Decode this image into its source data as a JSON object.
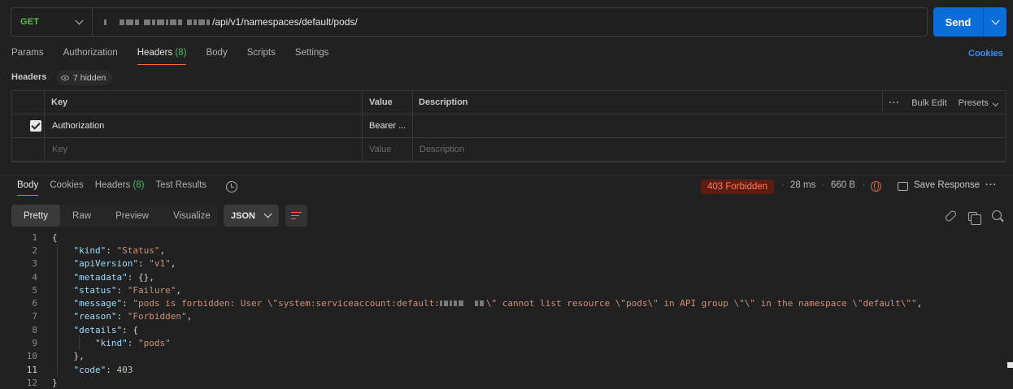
{
  "request": {
    "method": "GET",
    "url_path": "/api/v1/namespaces/default/pods/",
    "send_label": "Send"
  },
  "request_tabs": [
    {
      "label": "Params"
    },
    {
      "label": "Authorization"
    },
    {
      "label": "Headers",
      "count": "(8)"
    },
    {
      "label": "Body"
    },
    {
      "label": "Scripts"
    },
    {
      "label": "Settings"
    }
  ],
  "cookies_link": "Cookies",
  "headers_section": {
    "label": "Headers",
    "hidden": "7 hidden",
    "columns": {
      "key": "Key",
      "value": "Value",
      "description": "Description"
    },
    "actions": {
      "bulk_edit": "Bulk Edit",
      "presets": "Presets"
    },
    "rows": [
      {
        "key": "Authorization",
        "value": "Bearer ...",
        "description": "",
        "checked": true
      }
    ],
    "placeholder": {
      "key": "Key",
      "value": "Value",
      "description": "Description"
    }
  },
  "response_tabs": [
    {
      "label": "Body"
    },
    {
      "label": "Cookies"
    },
    {
      "label": "Headers",
      "count": "(8)"
    },
    {
      "label": "Test Results"
    }
  ],
  "response_meta": {
    "status": "403 Forbidden",
    "time": "28 ms",
    "size": "660 B",
    "save_label": "Save Response",
    "status_color": "#ff7b5c"
  },
  "view_modes": [
    "Pretty",
    "Raw",
    "Preview",
    "Visualize"
  ],
  "format": "JSON",
  "code_lines": [
    "1",
    "2",
    "3",
    "4",
    "5",
    "6",
    "7",
    "8",
    "9",
    "10",
    "11",
    "12"
  ],
  "code": {
    "kind": "\"Status\"",
    "apiVersion": "\"v1\"",
    "metadata": "{}",
    "status": "\"Failure\"",
    "message_start": "\"pods is forbidden: User \\\"system:serviceaccount:default:",
    "message_end": "\\\" cannot list resource \\\"pods\\\" in API group \\\"\\\" in the namespace \\\"default\\\"\"",
    "reason": "\"Forbidden\"",
    "details_kind": "\"pods\"",
    "code": "403"
  }
}
